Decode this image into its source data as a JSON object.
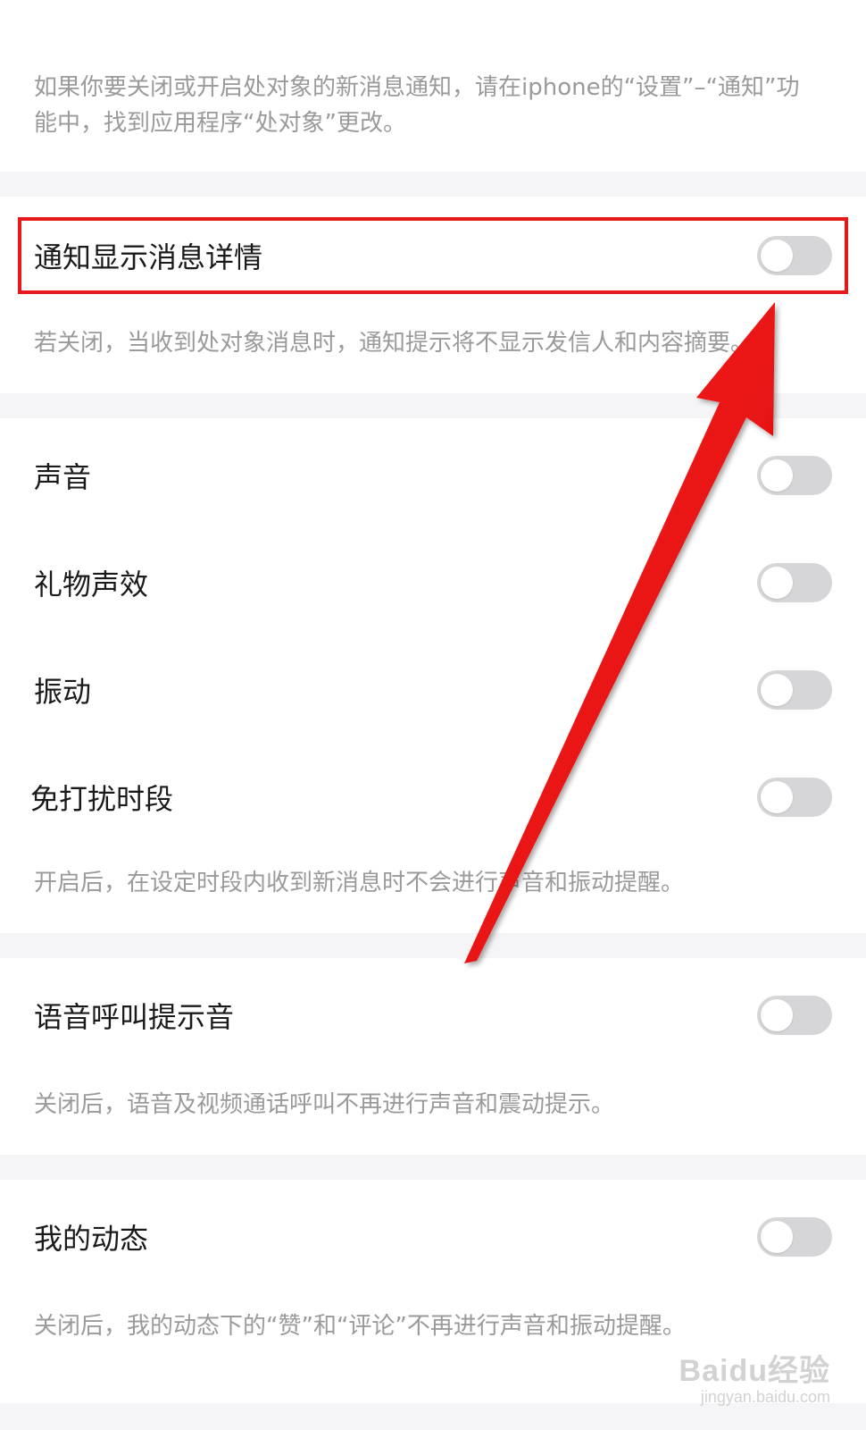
{
  "intro": {
    "text": "如果你要关闭或开启处对象的新消息通知，请在iphone的“设置”–“通知”功能中，找到应用程序“处对象”更改。"
  },
  "settings": {
    "notify_details": {
      "label": "通知显示消息详情",
      "enabled": false,
      "desc": "若关闭，当收到处对象消息时，通知提示将不显示发信人和内容摘要。"
    },
    "sound": {
      "label": "声音",
      "enabled": false
    },
    "gift_sound": {
      "label": "礼物声效",
      "enabled": false
    },
    "vibration": {
      "label": "振动",
      "enabled": false
    },
    "dnd": {
      "label": "免打扰时段",
      "enabled": false,
      "desc": "开启后，在设定时段内收到新消息时不会进行声音和振动提醒。"
    },
    "voice_call": {
      "label": "语音呼叫提示音",
      "enabled": false,
      "desc": "关闭后，语音及视频通话呼叫不再进行声音和震动提示。"
    },
    "my_moments": {
      "label": "我的动态",
      "enabled": false,
      "desc": "关闭后，我的动态下的“赞”和“评论”不再进行声音和振动提醒。"
    }
  },
  "watermark": {
    "brand": "Baidu经验",
    "url": "jingyan.baidu.com"
  },
  "colors": {
    "highlight": "#e8191b",
    "toggle_off": "#d6d6d8",
    "page_bg": "#f5f5f7",
    "desc_text": "#9a9a9a"
  },
  "icons": {
    "annotation_arrow": "arrow-up-right-icon"
  }
}
